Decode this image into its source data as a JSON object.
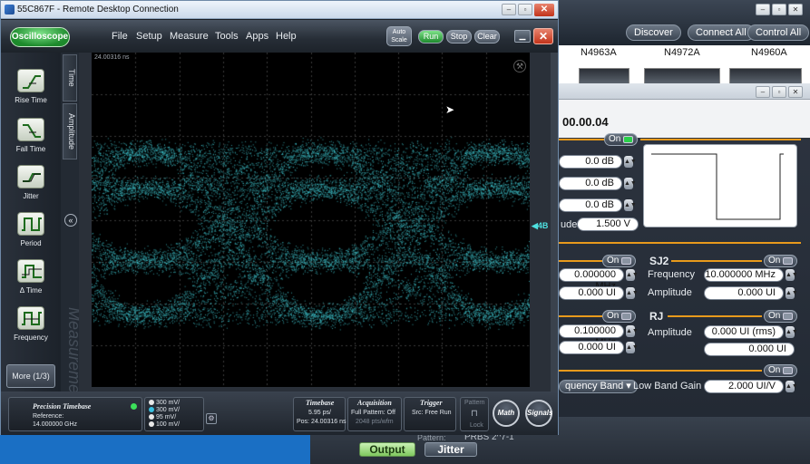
{
  "rdp": {
    "title": "55C867F - Remote Desktop Connection"
  },
  "scope": {
    "logo": "Oscilloscope",
    "menu": [
      "File",
      "Setup",
      "Measure",
      "Tools",
      "Apps",
      "Help"
    ],
    "buttons": {
      "auto_scale": "Auto Scale",
      "run": "Run",
      "stop": "Stop",
      "clear": "Clear"
    },
    "tools": [
      "Rise Time",
      "Fall Time",
      "Jitter",
      "Period",
      "Δ Time",
      "Frequency"
    ],
    "more": "More (1/3)",
    "tabs": [
      "Time",
      "Amplitude"
    ],
    "watermark": "Measurements",
    "timestamp": "24.00316 ns",
    "level_marker": "◀4B",
    "status": {
      "precision_title": "Precision Timebase",
      "reference_label": "Reference:",
      "reference_value": "14.000000 GHz",
      "channels": [
        "300 mV/",
        "300 mV/",
        "95 mV/",
        "100 mV/"
      ],
      "channel_colors": [
        "#e8e8e8",
        "#38c0e0",
        "#e8e8e8",
        "#e8e8e8"
      ],
      "timebase_title": "Timebase",
      "timebase_value": "5.95 ps/",
      "timebase_pos": "Pos: 24.00316 ns",
      "acq_title": "Acquisition",
      "acq_value": "Full Pattern: Off",
      "acq_sub": "2048 pts/wfm",
      "trig_title": "Trigger",
      "trig_value": "Src: Free Run",
      "pattern": "Pattern",
      "lock": "Lock",
      "math": "Math",
      "signals": "Signals"
    }
  },
  "bg": {
    "top_buttons": [
      "Discover",
      "Connect All",
      "Control All"
    ],
    "instruments": [
      "N4963A",
      "N4972A",
      "N4960A"
    ],
    "device_id": "00.00.04",
    "on_label": "On",
    "db_values": [
      "0.0 dB",
      "0.0 dB",
      "0.0 dB"
    ],
    "amplitude_label_partial": "ude",
    "amplitude_value": "1.500 V",
    "sj1": {
      "freq": "0.000000 MHz",
      "amp": "0.000 UI"
    },
    "sj2": {
      "title": "SJ2",
      "freq_label": "Frequency",
      "freq": "10.000000 MHz",
      "amp_label": "Amplitude",
      "amp": "0.000 UI"
    },
    "pj": {
      "freq": "0.100000 MHz",
      "amp": "0.000 UI"
    },
    "rj": {
      "title": "RJ",
      "amp_label": "Amplitude",
      "amp_rms": "0.000 UI (rms)",
      "amp2": "0.000 UI"
    },
    "band_btn": "quency Band",
    "low_band_label": "Low Band Gain",
    "low_band_value": "2.000 UI/V",
    "pattern_partial": "Pattern:",
    "pattern_value": "PRBS 2^7-1",
    "output": "Output",
    "jitter": "Jitter"
  }
}
